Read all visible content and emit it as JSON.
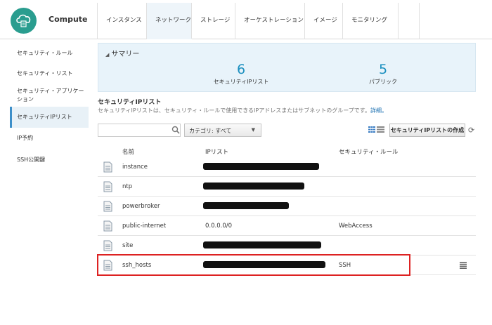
{
  "header": {
    "app_title": "Compute",
    "logo_icon": "cloud-server-icon",
    "tabs": [
      {
        "label": "インスタンス",
        "active": false
      },
      {
        "label": "ネットワーク",
        "active": true
      },
      {
        "label": "ストレージ",
        "active": false
      },
      {
        "label": "オーケストレーション",
        "active": false
      },
      {
        "label": "イメージ",
        "active": false
      },
      {
        "label": "モニタリング",
        "active": false
      },
      {
        "label": "",
        "active": false
      }
    ]
  },
  "sidebar": {
    "items": [
      {
        "label": "セキュリティ・ルール",
        "active": false
      },
      {
        "label": "セキュリティ・リスト",
        "active": false
      },
      {
        "label": "セキュリティ・アプリケーション",
        "active": false
      },
      {
        "label": "セキュリティIPリスト",
        "active": true
      },
      {
        "label": "IP予約",
        "active": false
      },
      {
        "label": "SSH公開鍵",
        "active": false
      }
    ]
  },
  "summary": {
    "title": "サマリー",
    "stats": [
      {
        "value": "6",
        "label": "セキュリティIPリスト"
      },
      {
        "value": "5",
        "label": "パブリック"
      }
    ]
  },
  "section": {
    "title": "セキュリティIPリスト",
    "description": "セキュリティIPリストは、セキュリティ・ルールで使用できるIPアドレスまたはサブネットのグループです。",
    "details_link": "詳細。"
  },
  "toolbar": {
    "search_value": "",
    "category_label": "カテゴリ: すべて",
    "create_button": "セキュリティIPリストの作成"
  },
  "table": {
    "columns": [
      "名前",
      "IPリスト",
      "セキュリティ・ルール"
    ],
    "rows": [
      {
        "name": "instance",
        "ip_list": "",
        "redacted": true,
        "rule": ""
      },
      {
        "name": "ntp",
        "ip_list": "",
        "redacted": true,
        "rule": ""
      },
      {
        "name": "powerbroker",
        "ip_list": "",
        "redacted": true,
        "rule": ""
      },
      {
        "name": "public-internet",
        "ip_list": "0.0.0.0/0",
        "redacted": false,
        "rule": "WebAccess"
      },
      {
        "name": "site",
        "ip_list": "",
        "redacted": true,
        "rule": ""
      },
      {
        "name": "ssh_hosts",
        "ip_list": "",
        "redacted": true,
        "rule": "SSH",
        "highlighted": true
      }
    ]
  },
  "colors": {
    "accent": "#1a8fbf",
    "logo": "#2a9d8f",
    "summary_bg": "#e8f3fa",
    "highlight_border": "#dd2222"
  }
}
